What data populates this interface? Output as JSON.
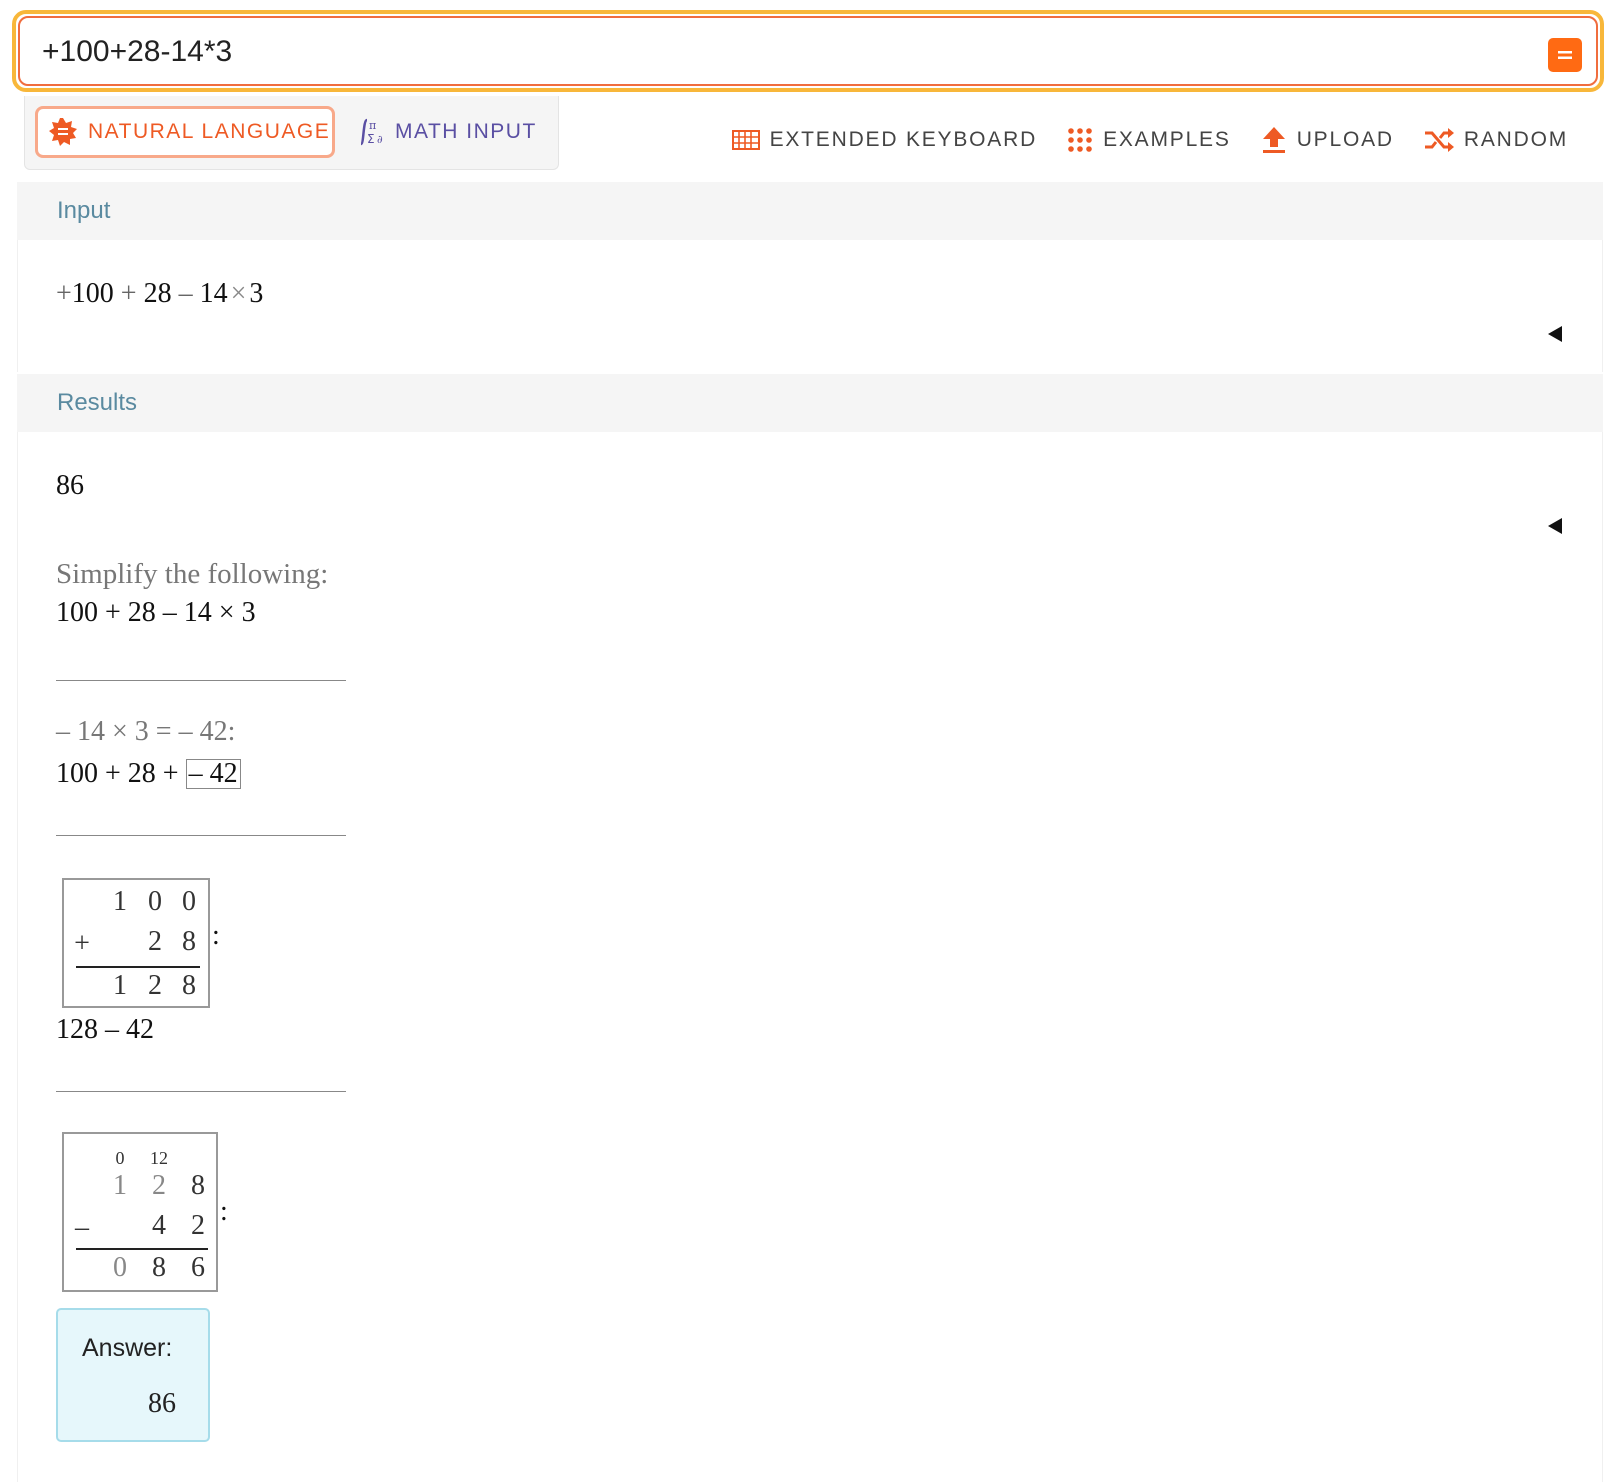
{
  "query": {
    "value": "+100+28-14*3"
  },
  "modes": {
    "natural_language": "NATURAL LANGUAGE",
    "math_input": "MATH INPUT"
  },
  "toolbar": {
    "extended_keyboard": "EXTENDED KEYBOARD",
    "examples": "EXAMPLES",
    "upload": "UPLOAD",
    "random": "RANDOM"
  },
  "input_pod": {
    "title": "Input",
    "expr": {
      "t1": "+",
      "n1": "100",
      "t2": "+",
      "n2": "28",
      "t3": "–",
      "n3": "14",
      "t4": "×",
      "n4": "3"
    }
  },
  "results_pod": {
    "title": "Results",
    "value": "86",
    "step1": {
      "heading": "Simplify the following:",
      "expr": "100 + 28 – 14 × 3"
    },
    "step2": {
      "heading": "– 14 × 3 = – 42:",
      "expr_prefix": "100 + 28 + ",
      "boxed": "– 42"
    },
    "step3": {
      "row1": [
        "1",
        "0",
        "0"
      ],
      "op": "+",
      "row2": [
        "2",
        "8"
      ],
      "row3": [
        "1",
        "2",
        "8"
      ],
      "colon": ":",
      "after": "128 – 42"
    },
    "step4": {
      "carry": [
        "0",
        "12"
      ],
      "row1": [
        "1",
        "2",
        "8"
      ],
      "op": "–",
      "row2": [
        "4",
        "2"
      ],
      "row3": [
        "0",
        "8",
        "6"
      ],
      "colon": ":"
    },
    "answer": {
      "label": "Answer:",
      "value": "86"
    }
  },
  "colors": {
    "accent": "#ff6a13",
    "query_border": "#f8b73a",
    "pod_title": "#5a8aa0",
    "answer_bg": "#e6f7fb"
  }
}
